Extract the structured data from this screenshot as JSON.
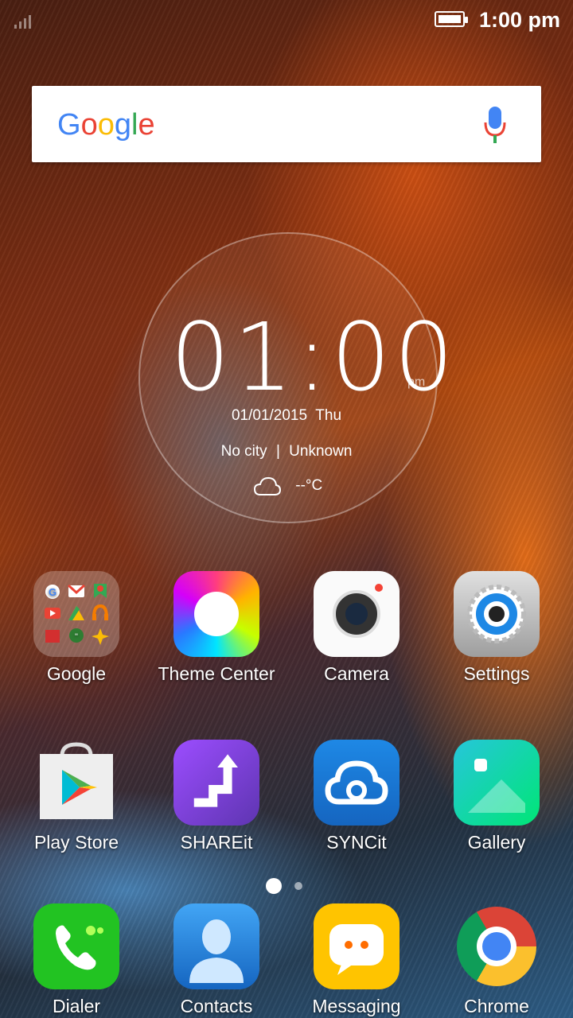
{
  "status_bar": {
    "time": "1:00 pm",
    "battery_icon": "battery-full-icon",
    "signal_icon": "signal-icon"
  },
  "search": {
    "logo": "Google",
    "mic_icon": "mic-icon"
  },
  "clock_widget": {
    "time": "01:00",
    "ampm": "pm",
    "date": "01/01/2015  Thu",
    "city": "No city",
    "status": "Unknown",
    "separator": "|",
    "temp": "--°C",
    "weather_icon": "cloud-icon"
  },
  "apps": [
    {
      "label": "Google",
      "icon": "google-folder-icon"
    },
    {
      "label": "Theme Center",
      "icon": "theme-center-icon"
    },
    {
      "label": "Camera",
      "icon": "camera-icon"
    },
    {
      "label": "Settings",
      "icon": "settings-icon"
    },
    {
      "label": "Play Store",
      "icon": "play-store-icon"
    },
    {
      "label": "SHAREit",
      "icon": "shareit-icon"
    },
    {
      "label": "SYNCit",
      "icon": "syncit-icon"
    },
    {
      "label": "Gallery",
      "icon": "gallery-icon"
    }
  ],
  "dock": [
    {
      "label": "Dialer",
      "icon": "dialer-icon"
    },
    {
      "label": "Contacts",
      "icon": "contacts-icon"
    },
    {
      "label": "Messaging",
      "icon": "messaging-icon"
    },
    {
      "label": "Chrome",
      "icon": "chrome-icon"
    }
  ],
  "pages": {
    "count": 2,
    "current": 1
  },
  "colors": {
    "google_blue": "#4285F4",
    "google_red": "#EA4335",
    "google_yellow": "#FBBC05",
    "google_green": "#34A853"
  }
}
